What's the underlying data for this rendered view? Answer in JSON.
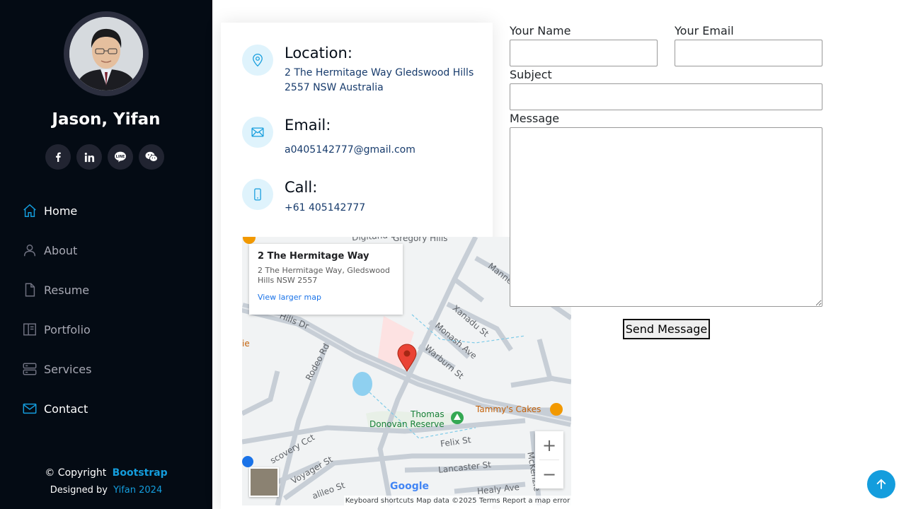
{
  "profile": {
    "name": "Jason, Yifan",
    "socials": [
      {
        "icon": "facebook-icon",
        "glyph": "f"
      },
      {
        "icon": "linkedin-icon",
        "glyph": "in"
      },
      {
        "icon": "line-icon",
        "glyph": "LINE"
      },
      {
        "icon": "wechat-icon",
        "glyph": "W"
      }
    ]
  },
  "nav": {
    "items": [
      {
        "label": "Home",
        "icon": "home-icon",
        "active": true
      },
      {
        "label": "About",
        "icon": "person-icon",
        "active": false
      },
      {
        "label": "Resume",
        "icon": "file-icon",
        "active": false
      },
      {
        "label": "Portfolio",
        "icon": "book-icon",
        "active": false
      },
      {
        "label": "Services",
        "icon": "server-icon",
        "active": false
      },
      {
        "label": "Contact",
        "icon": "envelope-icon",
        "active": true
      }
    ]
  },
  "footer": {
    "copyright_prefix": "© Copyright",
    "copyright_link": "Bootstrap",
    "designed_prefix": "Designed by",
    "designed_link": "Yifan 2024"
  },
  "contact_info": {
    "location": {
      "title": "Location:",
      "text": "2 The Hermitage Way Gledswood Hills 2557 NSW Australia",
      "icon": "map-pin-icon"
    },
    "email": {
      "title": "Email:",
      "text": "a0405142777@gmail.com",
      "icon": "envelope-icon"
    },
    "call": {
      "title": "Call:",
      "text": "+61 405142777",
      "icon": "phone-icon"
    }
  },
  "map": {
    "card_title": "2 The Hermitage Way",
    "card_address": "2 The Hermitage Way, Gledswood Hills NSW 2557",
    "card_link": "View larger map",
    "zoom_in": "+",
    "zoom_out": "−",
    "google": "Google",
    "attribution": [
      "Keyboard shortcuts",
      "Map data ©2025",
      "Terms",
      "Report a map error"
    ],
    "labels": {
      "gregory_hills": "Gregory Hills",
      "digitand": "Digitand D",
      "manne": "Manne",
      "xanadu": "Xanadu St",
      "monash": "Monash Ave",
      "warburn": "Warburn St",
      "hills_dr": "Hills Dr",
      "rodeo": "Rodeo Rd",
      "ie": "ie",
      "thomas": "Thomas",
      "donovan": "Donovan Reserve",
      "tammys": "Tammy's Cakes",
      "felix": "Felix St",
      "lancaster": "Lancaster St",
      "voyager": "Voyager St",
      "discovery": "scovery Cct",
      "galileo": "alileo St",
      "healy": "Healy Ave",
      "mckenzie": "McKenzie"
    }
  },
  "form": {
    "name_label": "Your Name",
    "email_label": "Your Email",
    "subject_label": "Subject",
    "message_label": "Message",
    "name_value": "",
    "email_value": "",
    "subject_value": "",
    "message_value": "",
    "submit_label": "Send Message"
  },
  "colors": {
    "accent": "#149ddd",
    "sidebar_bg": "#040b14",
    "social_bg": "#212431"
  }
}
